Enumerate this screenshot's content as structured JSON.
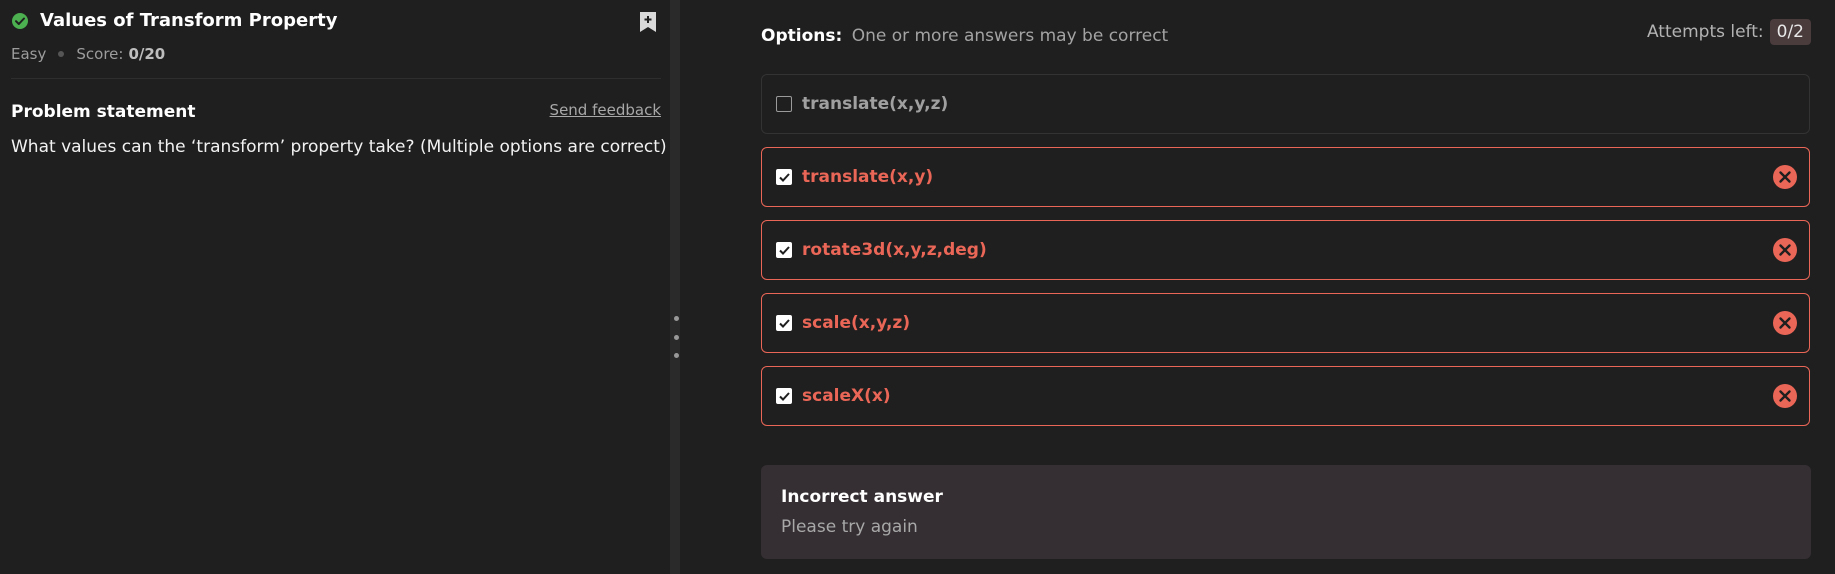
{
  "problem": {
    "title": "Values of Transform Property",
    "difficulty": "Easy",
    "score_label": "Score:",
    "score_value": "0/20",
    "statement_heading": "Problem statement",
    "feedback_link": "Send feedback",
    "question": "What values can the ‘transform’ property take? (Multiple options are correct)",
    "status_icon": "check-circle-icon",
    "bookmark_icon": "bookmark-add-icon"
  },
  "options_panel": {
    "label": "Options:",
    "hint": "One or more answers may be correct",
    "attempts_label": "Attempts left:",
    "attempts_value": "0/2",
    "options": [
      {
        "label": "translate(x,y,z)",
        "checked": false,
        "state": "neutral"
      },
      {
        "label": "translate(x,y)",
        "checked": true,
        "state": "incorrect"
      },
      {
        "label": "rotate3d(x,y,z,deg)",
        "checked": true,
        "state": "incorrect"
      },
      {
        "label": "scale(x,y,z)",
        "checked": true,
        "state": "incorrect"
      },
      {
        "label": "scaleX(x)",
        "checked": true,
        "state": "incorrect"
      }
    ]
  },
  "result": {
    "title": "Incorrect answer",
    "subtitle": "Please try again"
  },
  "colors": {
    "background": "#1f1f1f",
    "error": "#ea6657",
    "success": "#4caf50",
    "result_bg": "#352f33"
  }
}
